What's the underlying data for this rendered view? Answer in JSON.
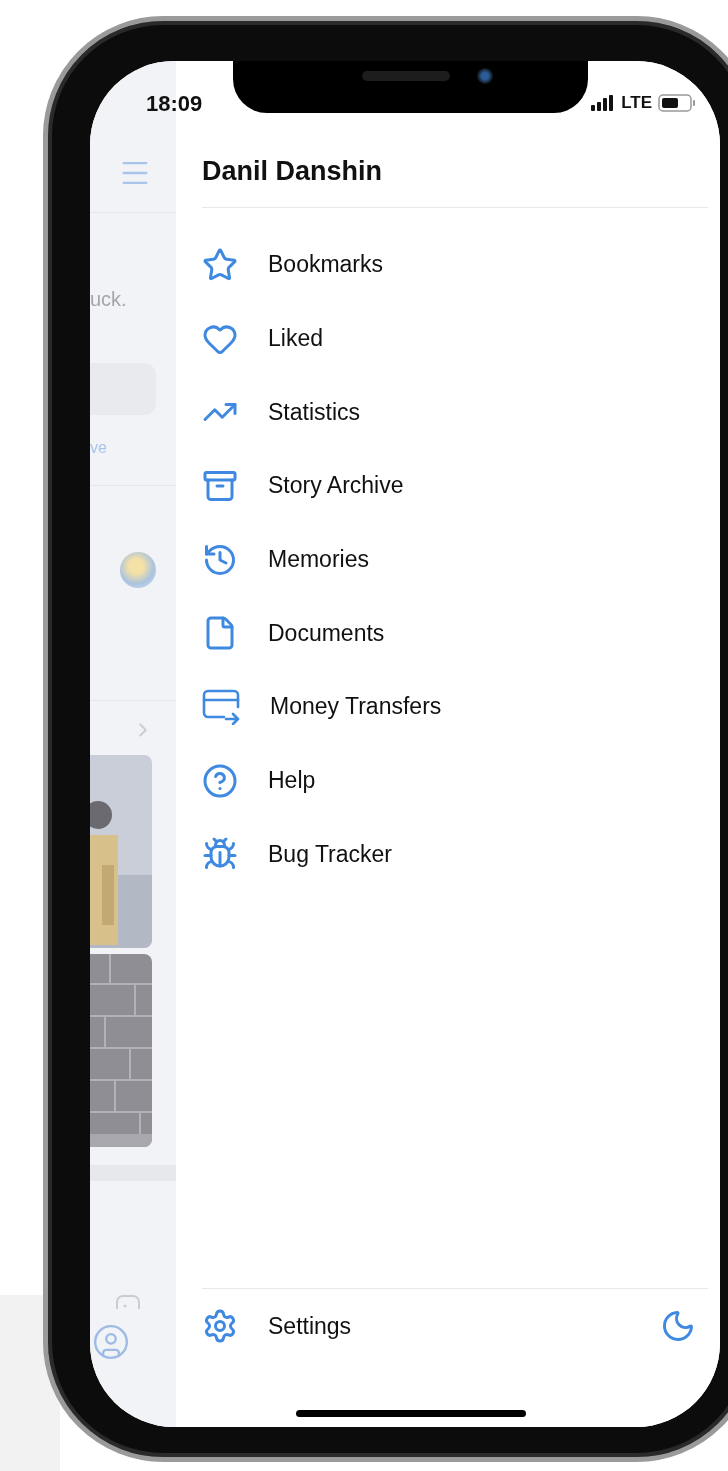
{
  "status_bar": {
    "time": "18:09",
    "network": "LTE"
  },
  "background_screen": {
    "text_fragment": "uck.",
    "tab_fragment": "ve"
  },
  "drawer": {
    "title": "Danil Danshin",
    "items": [
      {
        "label": "Bookmarks",
        "kind": "star"
      },
      {
        "label": "Liked",
        "kind": "heart"
      },
      {
        "label": "Statistics",
        "kind": "chart"
      },
      {
        "label": "Story Archive",
        "kind": "archive"
      },
      {
        "label": "Memories",
        "kind": "history"
      },
      {
        "label": "Documents",
        "kind": "document"
      },
      {
        "label": "Money Transfers",
        "kind": "transfer"
      },
      {
        "label": "Help",
        "kind": "help"
      },
      {
        "label": "Bug Tracker",
        "kind": "bug"
      }
    ],
    "footer": {
      "label": "Settings"
    }
  }
}
